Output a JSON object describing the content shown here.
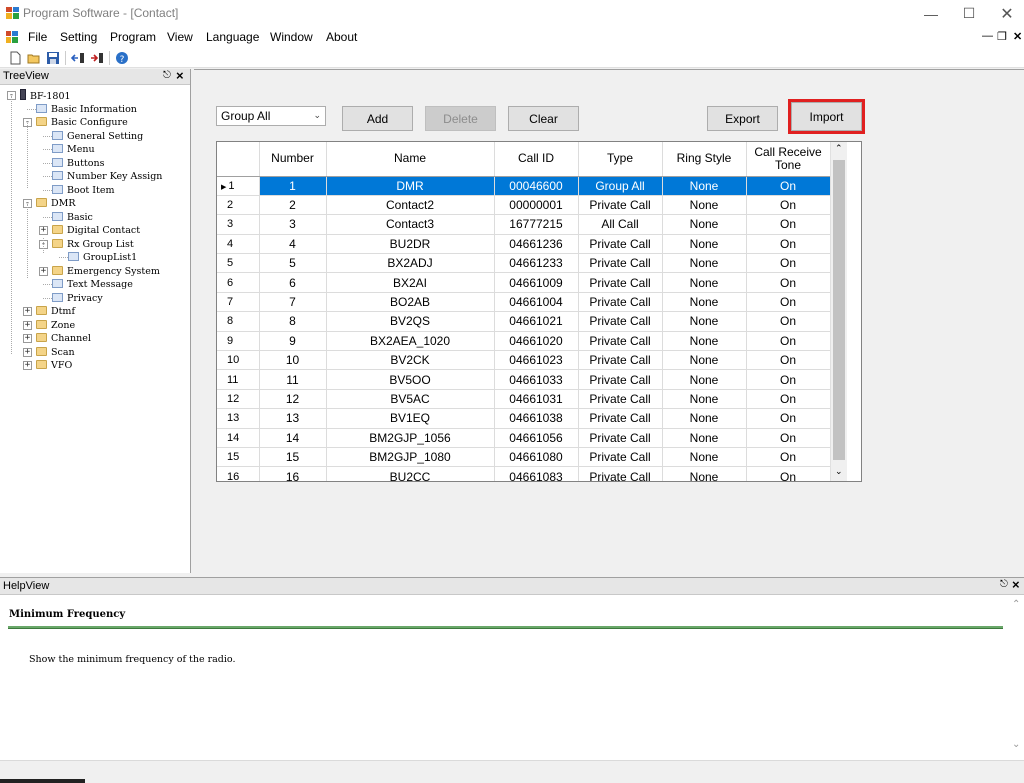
{
  "window": {
    "title": "Program Software - [Contact]"
  },
  "menu": [
    "File",
    "Setting",
    "Program",
    "View",
    "Language",
    "Window",
    "About"
  ],
  "tree": {
    "title": "TreeView",
    "nodes": [
      {
        "label": "BF-1801",
        "level": 0,
        "icon": "radio-icon",
        "expander": "-"
      },
      {
        "label": "Basic Information",
        "level": 1,
        "icon": "wrench-icon"
      },
      {
        "label": "Basic Configure",
        "level": 1,
        "icon": "folder-icon",
        "expander": "-"
      },
      {
        "label": "General Setting",
        "level": 2,
        "icon": "settings-icon"
      },
      {
        "label": "Menu",
        "level": 2,
        "icon": "list-icon"
      },
      {
        "label": "Buttons",
        "level": 2,
        "icon": "cursor-icon"
      },
      {
        "label": "Number Key Assign",
        "level": 2,
        "icon": "grid-icon"
      },
      {
        "label": "Boot Item",
        "level": 2,
        "icon": "page-icon"
      },
      {
        "label": "DMR",
        "level": 1,
        "icon": "folder-icon",
        "expander": "-"
      },
      {
        "label": "Basic",
        "level": 2,
        "icon": "settings-icon"
      },
      {
        "label": "Digital Contact",
        "level": 2,
        "icon": "folder-icon",
        "expander": "+"
      },
      {
        "label": "Rx Group List",
        "level": 2,
        "icon": "folder-icon",
        "expander": "-"
      },
      {
        "label": "GroupList1",
        "level": 3,
        "icon": "globe-icon"
      },
      {
        "label": "Emergency System",
        "level": 2,
        "icon": "folder-icon",
        "expander": "+"
      },
      {
        "label": "Text Message",
        "level": 2,
        "icon": "envelope-icon"
      },
      {
        "label": "Privacy",
        "level": 2,
        "icon": "lock-icon"
      },
      {
        "label": "Dtmf",
        "level": 1,
        "icon": "folder-icon",
        "expander": "+"
      },
      {
        "label": "Zone",
        "level": 1,
        "icon": "folder-icon",
        "expander": "+"
      },
      {
        "label": "Channel",
        "level": 1,
        "icon": "folder-icon",
        "expander": "+"
      },
      {
        "label": "Scan",
        "level": 1,
        "icon": "folder-icon",
        "expander": "+"
      },
      {
        "label": "VFO",
        "level": 1,
        "icon": "folder-icon",
        "expander": "+"
      }
    ]
  },
  "toolbar": {
    "group_select": "Group All",
    "add": "Add",
    "delete": "Delete",
    "clear": "Clear",
    "export": "Export",
    "import": "Import"
  },
  "grid": {
    "columns": [
      "Number",
      "Name",
      "Call ID",
      "Type",
      "Ring Style",
      "Call Receive Tone"
    ],
    "rows": [
      [
        "1",
        "DMR",
        "00046600",
        "Group All",
        "None",
        "On"
      ],
      [
        "2",
        "Contact2",
        "00000001",
        "Private Call",
        "None",
        "On"
      ],
      [
        "3",
        "Contact3",
        "16777215",
        "All Call",
        "None",
        "On"
      ],
      [
        "4",
        "BU2DR",
        "04661236",
        "Private Call",
        "None",
        "On"
      ],
      [
        "5",
        "BX2ADJ",
        "04661233",
        "Private Call",
        "None",
        "On"
      ],
      [
        "6",
        "BX2AI",
        "04661009",
        "Private Call",
        "None",
        "On"
      ],
      [
        "7",
        "BO2AB",
        "04661004",
        "Private Call",
        "None",
        "On"
      ],
      [
        "8",
        "BV2QS",
        "04661021",
        "Private Call",
        "None",
        "On"
      ],
      [
        "9",
        "BX2AEA_1020",
        "04661020",
        "Private Call",
        "None",
        "On"
      ],
      [
        "10",
        "BV2CK",
        "04661023",
        "Private Call",
        "None",
        "On"
      ],
      [
        "11",
        "BV5OO",
        "04661033",
        "Private Call",
        "None",
        "On"
      ],
      [
        "12",
        "BV5AC",
        "04661031",
        "Private Call",
        "None",
        "On"
      ],
      [
        "13",
        "BV1EQ",
        "04661038",
        "Private Call",
        "None",
        "On"
      ],
      [
        "14",
        "BM2GJP_1056",
        "04661056",
        "Private Call",
        "None",
        "On"
      ],
      [
        "15",
        "BM2GJP_1080",
        "04661080",
        "Private Call",
        "None",
        "On"
      ],
      [
        "16",
        "BU2CC",
        "04661083",
        "Private Call",
        "None",
        "On"
      ]
    ]
  },
  "help": {
    "title": "HelpView",
    "heading": "Minimum Frequency",
    "text": "Show the minimum frequency of the radio."
  },
  "colors": {
    "selection": "#0078d7",
    "highlight": "#e02020",
    "help_rule": "#6aa86a"
  }
}
